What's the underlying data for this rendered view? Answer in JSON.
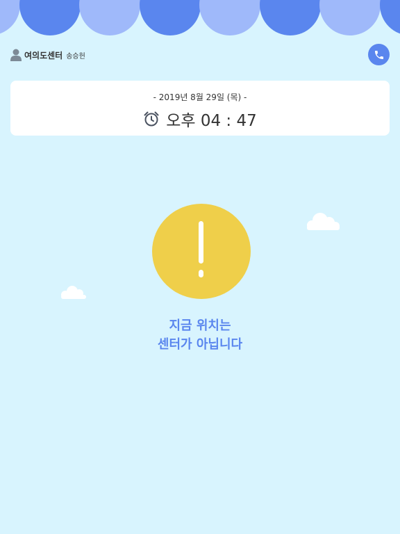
{
  "header": {
    "center_name": "여의도센터",
    "user_name": "송승헌",
    "icons": {
      "user": "user-icon",
      "phone": "phone-icon"
    }
  },
  "date_card": {
    "date_text": "- 2019년 8월 29일 (목) -",
    "time_text": "오후 04 : 47",
    "clock_icon": "alarm-clock-icon"
  },
  "alert": {
    "icon": "exclamation-icon",
    "line1": "지금 위치는",
    "line2": "센터가 아닙니다"
  },
  "colors": {
    "background": "#d8f4fe",
    "awning_dark": "#5a86ee",
    "awning_light": "#9fb9fa",
    "accent": "#5a86ee",
    "alert_yellow": "#efcf4a"
  }
}
